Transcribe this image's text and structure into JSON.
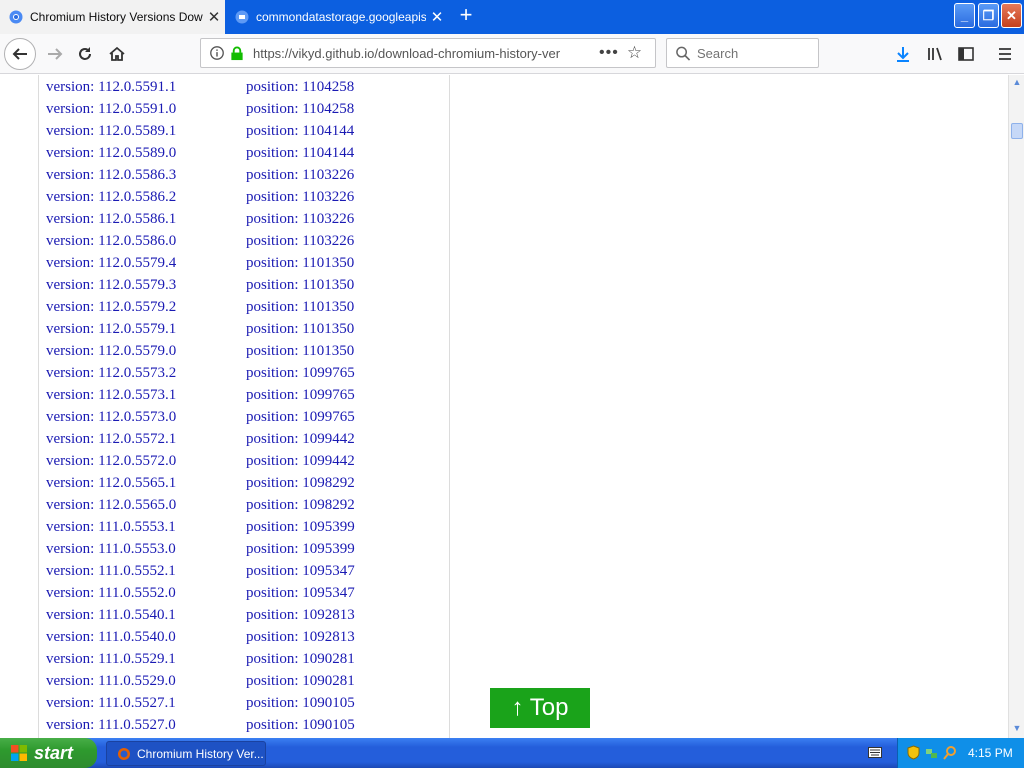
{
  "browser": {
    "tabs": [
      {
        "title": "Chromium History Versions Downlo",
        "active": true
      },
      {
        "title": "commondatastorage.googleapis.c",
        "active": false
      }
    ],
    "url": "https://vikyd.github.io/download-chromium-history-ver",
    "search_placeholder": "Search"
  },
  "page": {
    "rows": [
      {
        "version": "version: 112.0.5591.1",
        "position": "position: 1104258"
      },
      {
        "version": "version: 112.0.5591.0",
        "position": "position: 1104258"
      },
      {
        "version": "version: 112.0.5589.1",
        "position": "position: 1104144"
      },
      {
        "version": "version: 112.0.5589.0",
        "position": "position: 1104144"
      },
      {
        "version": "version: 112.0.5586.3",
        "position": "position: 1103226"
      },
      {
        "version": "version: 112.0.5586.2",
        "position": "position: 1103226"
      },
      {
        "version": "version: 112.0.5586.1",
        "position": "position: 1103226"
      },
      {
        "version": "version: 112.0.5586.0",
        "position": "position: 1103226"
      },
      {
        "version": "version: 112.0.5579.4",
        "position": "position: 1101350"
      },
      {
        "version": "version: 112.0.5579.3",
        "position": "position: 1101350"
      },
      {
        "version": "version: 112.0.5579.2",
        "position": "position: 1101350"
      },
      {
        "version": "version: 112.0.5579.1",
        "position": "position: 1101350"
      },
      {
        "version": "version: 112.0.5579.0",
        "position": "position: 1101350"
      },
      {
        "version": "version: 112.0.5573.2",
        "position": "position: 1099765"
      },
      {
        "version": "version: 112.0.5573.1",
        "position": "position: 1099765"
      },
      {
        "version": "version: 112.0.5573.0",
        "position": "position: 1099765"
      },
      {
        "version": "version: 112.0.5572.1",
        "position": "position: 1099442"
      },
      {
        "version": "version: 112.0.5572.0",
        "position": "position: 1099442"
      },
      {
        "version": "version: 112.0.5565.1",
        "position": "position: 1098292"
      },
      {
        "version": "version: 112.0.5565.0",
        "position": "position: 1098292"
      },
      {
        "version": "version: 111.0.5553.1",
        "position": "position: 1095399"
      },
      {
        "version": "version: 111.0.5553.0",
        "position": "position: 1095399"
      },
      {
        "version": "version: 111.0.5552.1",
        "position": "position: 1095347"
      },
      {
        "version": "version: 111.0.5552.0",
        "position": "position: 1095347"
      },
      {
        "version": "version: 111.0.5540.1",
        "position": "position: 1092813"
      },
      {
        "version": "version: 111.0.5540.0",
        "position": "position: 1092813"
      },
      {
        "version": "version: 111.0.5529.1",
        "position": "position: 1090281"
      },
      {
        "version": "version: 111.0.5529.0",
        "position": "position: 1090281"
      },
      {
        "version": "version: 111.0.5527.1",
        "position": "position: 1090105"
      },
      {
        "version": "version: 111.0.5527.0",
        "position": "position: 1090105"
      }
    ],
    "top_button": "↑ Top"
  },
  "taskbar": {
    "start_label": "start",
    "task_label": "Chromium History Ver...",
    "clock": "4:15 PM"
  },
  "colors": {
    "link": "#1a1ab3",
    "top_button_bg": "#1aa31a",
    "titlebar": "#0c5fe0"
  }
}
